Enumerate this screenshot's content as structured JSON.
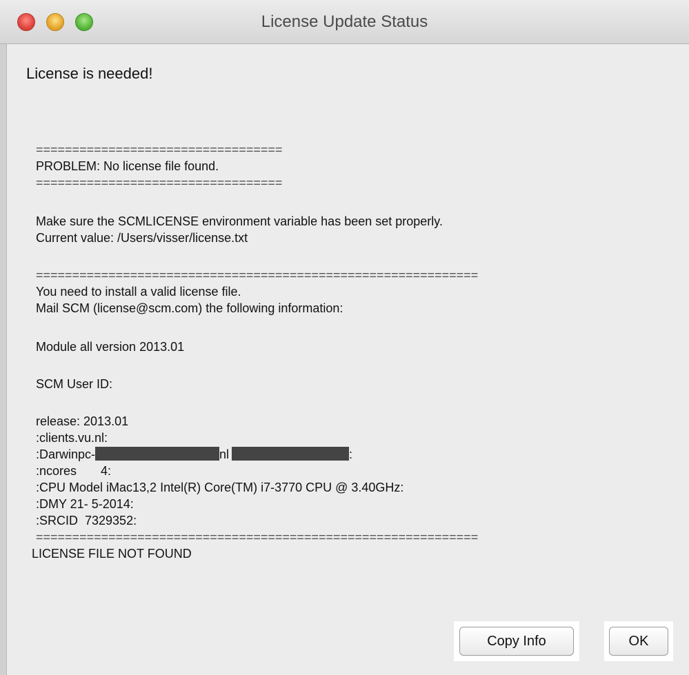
{
  "window": {
    "title": "License Update Status"
  },
  "dialog": {
    "headline": "License is needed!",
    "lines": [
      "==================================",
      "PROBLEM: No license file found.",
      "==================================",
      "Make sure the SCMLICENSE environment variable has been set properly.",
      "Current value: /Users/visser/license.txt",
      "=============================================================",
      "You need to install a valid license file.",
      "Mail SCM (license@scm.com) the following information:",
      "Module all version 2013.01",
      "SCM User ID:",
      "release: 2013.01",
      ":clients.vu.nl:",
      ":Darwinpc-",
      "nl",
      ":",
      ":ncores       4:",
      ":CPU Model iMac13,2 Intel(R) Core(TM) i7-3770 CPU @ 3.40GHz:",
      ":DMY 21- 5-2014:",
      ":SRCID  7329352:",
      "=============================================================",
      "LICENSE FILE NOT FOUND"
    ]
  },
  "buttons": {
    "copy_info": "Copy Info",
    "ok": "OK"
  },
  "colors": {
    "window_bg": "#ececec",
    "redaction": "#444444"
  }
}
